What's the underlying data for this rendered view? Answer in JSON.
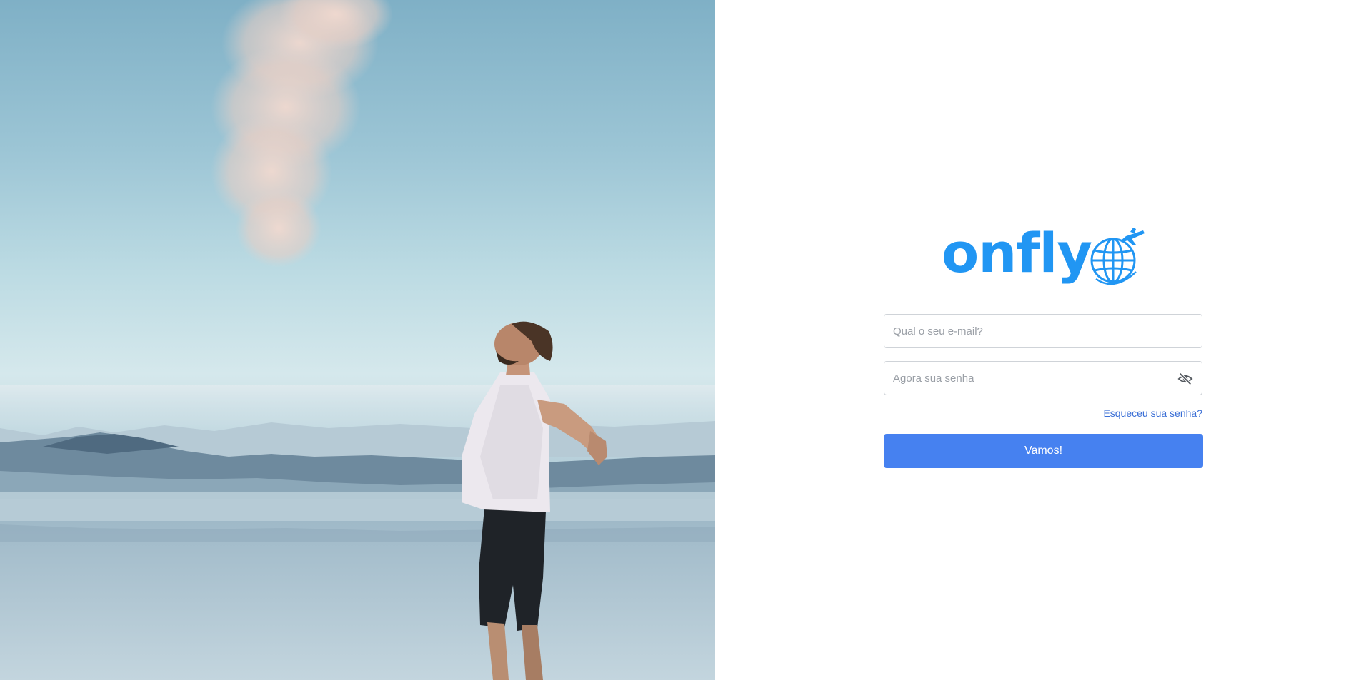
{
  "hero": {
    "image": "person-arms-outstretched-over-misty-lake"
  },
  "brand": {
    "name": "onfly",
    "icon": "globe-airplane-icon",
    "color": "#2196f3"
  },
  "login": {
    "email_placeholder": "Qual o seu e-mail?",
    "email_value": "",
    "password_placeholder": "Agora sua senha",
    "password_value": "",
    "toggle_visibility_icon": "eye-slash-icon",
    "forgot_label": "Esqueceu sua senha?",
    "submit_label": "Vamos!",
    "accent_color": "#4681f0",
    "link_color": "#3b6fd6"
  }
}
